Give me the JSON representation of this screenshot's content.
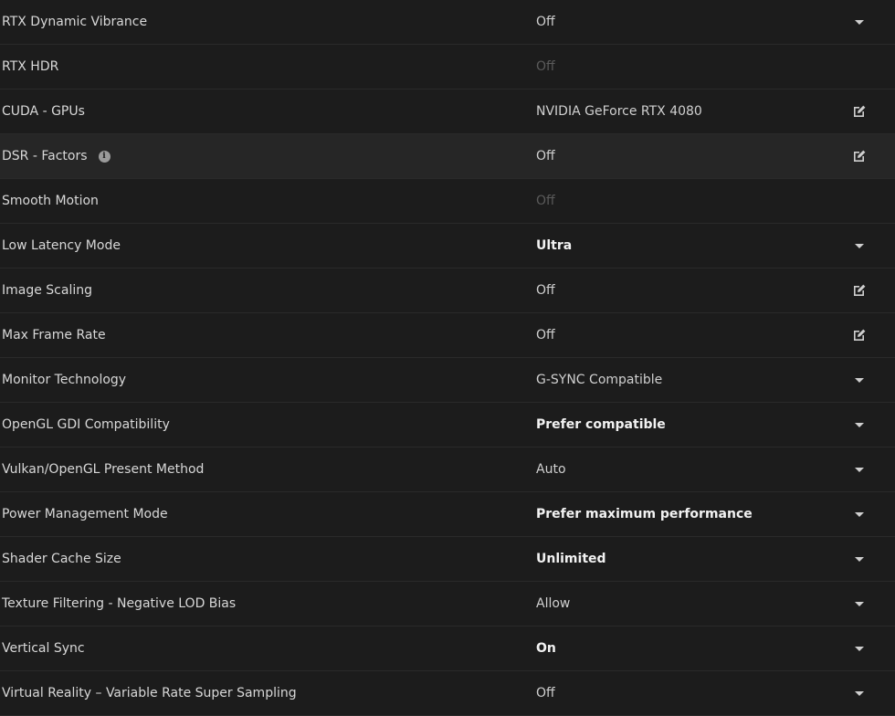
{
  "settings": [
    {
      "label": "RTX Dynamic Vibrance",
      "value": "Off",
      "control": "dropdown",
      "value_style": "normal"
    },
    {
      "label": "RTX HDR",
      "value": "Off",
      "control": "none",
      "value_style": "disabled"
    },
    {
      "label": "CUDA - GPUs",
      "value": "NVIDIA GeForce RTX 4080",
      "control": "edit",
      "value_style": "normal"
    },
    {
      "label": "DSR - Factors",
      "value": "Off",
      "control": "edit",
      "value_style": "normal",
      "info_icon": "i"
    },
    {
      "label": "Smooth Motion",
      "value": "Off",
      "control": "none",
      "value_style": "disabled"
    },
    {
      "label": "Low Latency Mode",
      "value": "Ultra",
      "control": "dropdown",
      "value_style": "bold"
    },
    {
      "label": "Image Scaling",
      "value": "Off",
      "control": "edit",
      "value_style": "normal"
    },
    {
      "label": "Max Frame Rate",
      "value": "Off",
      "control": "edit",
      "value_style": "normal"
    },
    {
      "label": "Monitor Technology",
      "value": "G-SYNC Compatible",
      "control": "dropdown",
      "value_style": "normal"
    },
    {
      "label": "OpenGL GDI Compatibility",
      "value": "Prefer compatible",
      "control": "dropdown",
      "value_style": "bold"
    },
    {
      "label": "Vulkan/OpenGL Present Method",
      "value": "Auto",
      "control": "dropdown",
      "value_style": "normal"
    },
    {
      "label": "Power Management Mode",
      "value": "Prefer maximum performance",
      "control": "dropdown",
      "value_style": "bold"
    },
    {
      "label": "Shader Cache Size",
      "value": "Unlimited",
      "control": "dropdown",
      "value_style": "bold"
    },
    {
      "label": "Texture Filtering - Negative LOD Bias",
      "value": "Allow",
      "control": "dropdown",
      "value_style": "normal"
    },
    {
      "label": "Vertical Sync",
      "value": "On",
      "control": "dropdown",
      "value_style": "bold"
    },
    {
      "label": "Virtual Reality – Variable Rate Super Sampling",
      "value": "Off",
      "control": "dropdown",
      "value_style": "normal"
    }
  ],
  "colors": {
    "background": "#1c1c1c",
    "highlight_row": "#262626",
    "divider": "#2a2a2a",
    "label_text": "#d8d8d8",
    "value_text": "#d0d0d0",
    "bold_value_text": "#f2f2f2",
    "disabled_text": "#5a5a5a",
    "icon": "#cfcfcf"
  },
  "icons": {
    "dropdown": "chevron-down-icon",
    "edit": "edit-icon",
    "info": "info-icon"
  },
  "hovered_row": "DSR - Factors"
}
